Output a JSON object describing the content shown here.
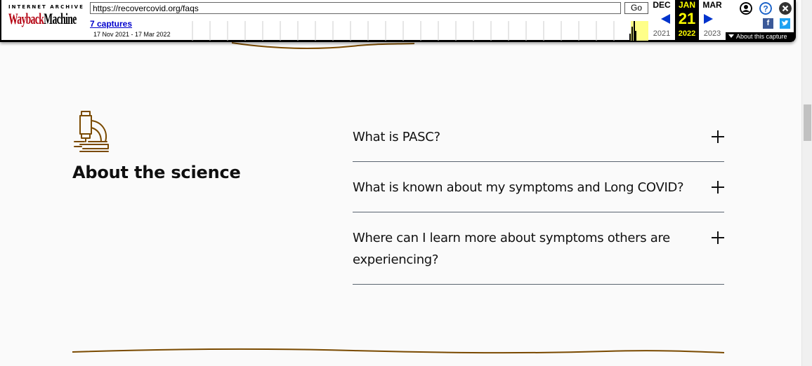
{
  "wayback": {
    "logo_top": "INTERNET ARCHIVE",
    "logo_word1": "Wayback",
    "logo_word2": "Machine",
    "url": "https://recovercovid.org/faqs",
    "go_label": "Go",
    "captures_label": "7 captures",
    "date_range": "17 Nov 2021 - 17 Mar 2022",
    "prev_month": "DEC",
    "prev_year": "2021",
    "cur_month": "JAN",
    "cur_day": "21",
    "cur_year": "2022",
    "next_month": "MAR",
    "next_year": "2023",
    "about_label": "About this capture",
    "icons": [
      "user-icon",
      "help-icon",
      "close-icon",
      "facebook-icon",
      "twitter-icon"
    ],
    "accent_color": "#0033cc",
    "highlight_color": "#ffff00"
  },
  "section": {
    "icon": "microscope-icon",
    "title": "About the science",
    "accent_color": "#7a4a00"
  },
  "faqs": [
    {
      "question": "What is PASC?"
    },
    {
      "question": "What is known about my symptoms and Long COVID?"
    },
    {
      "question": "Where can I learn more about symptoms others are experiencing?"
    }
  ]
}
